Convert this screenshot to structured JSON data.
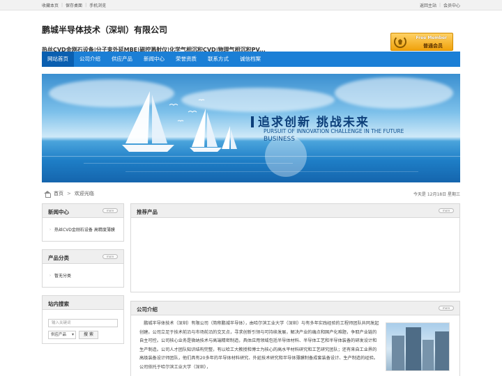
{
  "topbar": {
    "left": [
      "收藏本页",
      "保存桌面",
      "手机浏览"
    ],
    "right": [
      "返回主站",
      "会员中心"
    ]
  },
  "header": {
    "company": "鹏城半导体技术（深圳）有限公司",
    "tagline": "热丝CVD金刚石设备|分子束外延MBE|磁控溅射仪|化学气相沉积CVD|物理气相沉积PV...",
    "badge_line1": "Free Member",
    "badge_line2": "普通会员"
  },
  "nav": [
    "网站首页",
    "公司介绍",
    "供应产品",
    "新闻中心",
    "荣誉资质",
    "联系方式",
    "诚信档案"
  ],
  "banner": {
    "slogan": "追求创新 挑战未来",
    "en_line1": "PURSUIT OF INNOVATION CHALLENGE IN THE FUTURE",
    "en_line2": "BUSINESS"
  },
  "crumb": {
    "home": "首页",
    "current": "欢迎光临",
    "date": "今天是 12月18日 星期三"
  },
  "more_label": "more",
  "news": {
    "title": "新闻中心",
    "items": [
      "热丝CVD金刚石设备 高精度薄膜"
    ]
  },
  "category": {
    "title": "产品分类",
    "items": [
      "暂无分类"
    ]
  },
  "search": {
    "title": "站内搜索",
    "placeholder": "输入关键词",
    "select": "供应产品",
    "button": "搜 索"
  },
  "recommend": {
    "title": "推荐产品"
  },
  "about": {
    "title": "公司介绍",
    "text": "鹏城半导体技术（深圳）有限公司（简称鹏城半导体），由哈尔滨工业大学（深圳）与有多年实践经验的工程师团队共同发起创建。公司立足于技术前沿与市场前沿的交叉点，寻求创新引领与可持续发展，解决产业的痛点和国产化难题，争取产业链的自主可控。公司核心业务是微纳技术与高端精密制造，具体应用领域包括半导体材料、半导体工艺和半导体装备的研发设计和生产制造。公司人才团队知识结构完整，有以哈工大教授和博士为核心的高水平材料研究和工艺研究团队；还有来自工业界的高级装备设计师团队，他们具有20多年的半导体材料研究、外延技术研究和半导体薄膜制备成套装备设计、生产制造的经验。公司依托于哈尔滨工业大学（深圳），"
  }
}
